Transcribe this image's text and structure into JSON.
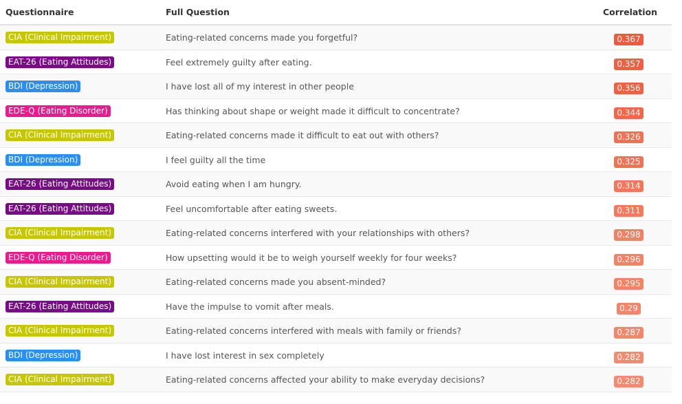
{
  "headers": {
    "questionnaire": "Questionnaire",
    "full_question": "Full Question",
    "correlation": "Correlation"
  },
  "questionnaire_colors": {
    "CIA (Clinical Impairment)": "#c6c700",
    "EAT-26 (Eating Attitudes)": "#7b0a8a",
    "BDI (Depression)": "#2a8ff2",
    "EDE-Q (Eating Disorder)": "#ec1a8c"
  },
  "correlation_color_scale": {
    "high": "#f15a3c",
    "low": "#f48a6e"
  },
  "rows": [
    {
      "questionnaire": "CIA (Clinical Impairment)",
      "question": "Eating-related concerns made you forgetful?",
      "correlation": "0.367"
    },
    {
      "questionnaire": "EAT-26 (Eating Attitudes)",
      "question": "Feel extremely guilty after eating.",
      "correlation": "0.357"
    },
    {
      "questionnaire": "BDI (Depression)",
      "question": "I have lost all of my interest in other people",
      "correlation": "0.356"
    },
    {
      "questionnaire": "EDE-Q (Eating Disorder)",
      "question": "Has thinking about shape or weight made it difficult to concentrate?",
      "correlation": "0.344"
    },
    {
      "questionnaire": "CIA (Clinical Impairment)",
      "question": "Eating-related concerns made it difficult to eat out with others?",
      "correlation": "0.326"
    },
    {
      "questionnaire": "BDI (Depression)",
      "question": "I feel guilty all the time",
      "correlation": "0.325"
    },
    {
      "questionnaire": "EAT-26 (Eating Attitudes)",
      "question": "Avoid eating when I am hungry.",
      "correlation": "0.314"
    },
    {
      "questionnaire": "EAT-26 (Eating Attitudes)",
      "question": "Feel uncomfortable after eating sweets.",
      "correlation": "0.311"
    },
    {
      "questionnaire": "CIA (Clinical Impairment)",
      "question": "Eating-related concerns interfered with your relationships with others?",
      "correlation": "0.298"
    },
    {
      "questionnaire": "EDE-Q (Eating Disorder)",
      "question": "How upsetting would it be to weigh yourself weekly for four weeks?",
      "correlation": "0.296"
    },
    {
      "questionnaire": "CIA (Clinical Impairment)",
      "question": "Eating-related concerns made you absent-minded?",
      "correlation": "0.295"
    },
    {
      "questionnaire": "EAT-26 (Eating Attitudes)",
      "question": "Have the impulse to vomit after meals.",
      "correlation": "0.29"
    },
    {
      "questionnaire": "CIA (Clinical Impairment)",
      "question": "Eating-related concerns interfered with meals with family or friends?",
      "correlation": "0.287"
    },
    {
      "questionnaire": "BDI (Depression)",
      "question": "I have lost interest in sex completely",
      "correlation": "0.282"
    },
    {
      "questionnaire": "CIA (Clinical Impairment)",
      "question": "Eating-related concerns affected your ability to make everyday decisions?",
      "correlation": "0.282"
    }
  ]
}
